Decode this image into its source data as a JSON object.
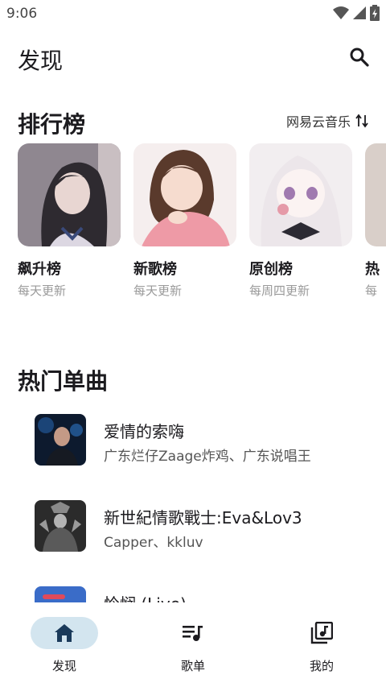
{
  "status": {
    "time": "9:06"
  },
  "header": {
    "title": "发现"
  },
  "rankings": {
    "title": "排行榜",
    "source_label": "网易云音乐",
    "items": [
      {
        "name": "飙升榜",
        "update": "每天更新"
      },
      {
        "name": "新歌榜",
        "update": "每天更新"
      },
      {
        "name": "原创榜",
        "update": "每周四更新"
      },
      {
        "name": "热",
        "update": "每"
      }
    ]
  },
  "hot_songs": {
    "title": "热门单曲",
    "items": [
      {
        "title": "爱情的索嗨",
        "artist": "广东烂仔Zaage炸鸡、广东说唱王"
      },
      {
        "title": "新世紀情歌戰士:Eva&Lov3",
        "artist": "Capper、kkluv"
      },
      {
        "title": "怜悯 (Live)",
        "artist": ""
      }
    ]
  },
  "nav": {
    "items": [
      {
        "label": "发现",
        "icon": "home-icon",
        "active": true
      },
      {
        "label": "歌单",
        "icon": "playlist-icon",
        "active": false
      },
      {
        "label": "我的",
        "icon": "library-music-icon",
        "active": false
      }
    ],
    "active_color": "#d3e5ef"
  }
}
